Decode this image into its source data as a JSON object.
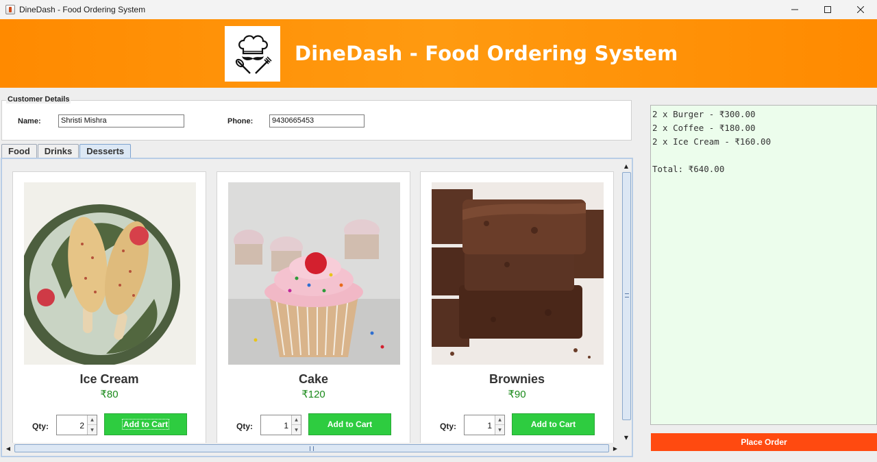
{
  "window": {
    "title": "DineDash - Food Ordering System",
    "controls": {
      "minimize": "—",
      "maximize": "☐",
      "close": "✕"
    }
  },
  "header": {
    "title": "DineDash - Food Ordering System",
    "logo_icon": "chef-hat-mustache-icon"
  },
  "customer": {
    "legend": "Customer Details",
    "name_label": "Name:",
    "name_value": "Shristi Mishra",
    "phone_label": "Phone:",
    "phone_value": "9430665453"
  },
  "tabs": [
    {
      "label": "Food",
      "active": false
    },
    {
      "label": "Drinks",
      "active": false
    },
    {
      "label": "Desserts",
      "active": true
    }
  ],
  "items": [
    {
      "name": "Ice Cream",
      "price": "₹80",
      "qty_label": "Qty:",
      "qty": "2",
      "button": "Add to Cart",
      "image": "ice-cream-bars-photo"
    },
    {
      "name": "Cake",
      "price": "₹120",
      "qty_label": "Qty:",
      "qty": "1",
      "button": "Add to Cart",
      "image": "cupcake-photo"
    },
    {
      "name": "Brownies",
      "price": "₹90",
      "qty_label": "Qty:",
      "qty": "1",
      "button": "Add to Cart",
      "image": "brownies-photo"
    }
  ],
  "order": {
    "lines": [
      "2 x Burger - ₹300.00",
      "2 x Coffee - ₹180.00",
      "2 x Ice Cream - ₹160.00",
      "",
      "Total: ₹640.00"
    ],
    "place_button": "Place Order"
  },
  "colors": {
    "header": "#ff8a00",
    "add_button": "#2ecc40",
    "place_button": "#ff4a10",
    "order_bg": "#ecfdec",
    "price": "#1a8a1a"
  }
}
